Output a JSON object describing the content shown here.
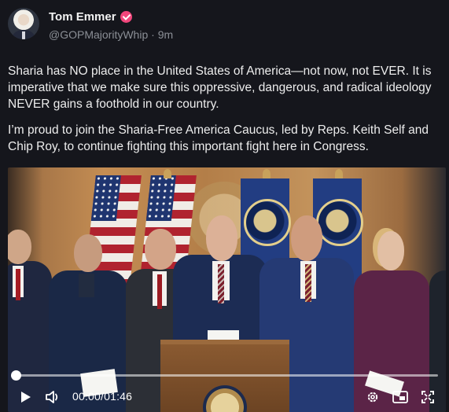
{
  "post": {
    "author_name": "Tom Emmer",
    "handle": "@GOPMajorityWhip",
    "separator": "·",
    "timestamp": "9m",
    "verified_color": "#f0467b",
    "paragraphs": [
      "Sharia has NO place in the United States of America—not now, not EVER. It is imperative that we make sure this oppressive, dangerous, and radical ideology NEVER gains a foothold in our country.",
      "I’m proud to join the Sharia-Free America Caucus, led by Reps. Keith Self and Chip Roy, to continue fighting this important fight here in Congress."
    ]
  },
  "video": {
    "time_display": "00:00/01:46",
    "progress": 0.0,
    "controls": {
      "play": "play-icon",
      "volume": "volume-icon",
      "settings": "gear-icon",
      "pip": "picture-in-picture-icon",
      "fullscreen": "fullscreen-icon"
    }
  }
}
